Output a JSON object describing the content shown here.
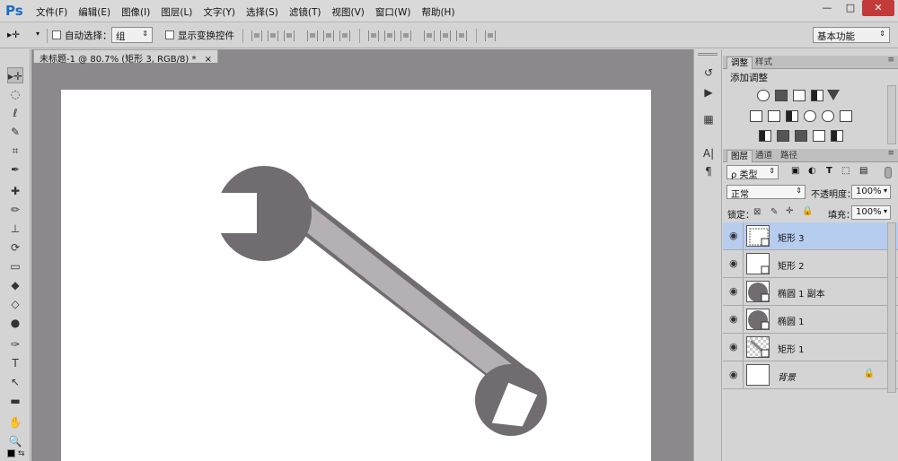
{
  "app": {
    "logo": "Ps"
  },
  "menu": [
    "文件(F)",
    "编辑(E)",
    "图像(I)",
    "图层(L)",
    "文字(Y)",
    "选择(S)",
    "滤镜(T)",
    "视图(V)",
    "窗口(W)",
    "帮助(H)"
  ],
  "window_controls": {
    "minimize": "—",
    "restore": "□",
    "close": "✕"
  },
  "options": {
    "move_tool": "▸✛",
    "auto_select_label": "自动选择：",
    "auto_select_value": "组",
    "show_transform_label": "显示变换控件",
    "workspace": "基本功能"
  },
  "document": {
    "tab_title": "未标题-1 @ 80.7% (矩形 3, RGB/8) *",
    "tab_close": "×"
  },
  "tools": [
    "▸✛",
    "◌",
    "ℓ",
    "✎",
    "⌗",
    "✒",
    "✚",
    "✏",
    "⊥",
    "⟳",
    "▭",
    "◆",
    "◇",
    "●",
    "✑",
    "T",
    "↖",
    "▬",
    "✋",
    "🔍"
  ],
  "mid_dock": [
    "↺",
    "▶",
    "▦",
    "A|",
    "¶"
  ],
  "adjustments": {
    "tabs": [
      "调整",
      "样式"
    ],
    "title": "添加调整"
  },
  "layers_panel": {
    "tabs": [
      "图层",
      "通道",
      "路径"
    ],
    "filter_kind": "ρ 类型",
    "blend_mode": "正常",
    "opacity_label": "不透明度：",
    "opacity_value": "100%",
    "lock_label": "锁定：",
    "fill_label": "填充：",
    "fill_value": "100%",
    "layers": [
      {
        "name": "矩形 3",
        "selected": true,
        "thumb": "rect-white-sq"
      },
      {
        "name": "矩形 2",
        "selected": false,
        "thumb": "rect-white-sq"
      },
      {
        "name": "椭圆 1 副本",
        "selected": false,
        "thumb": "ellipse"
      },
      {
        "name": "椭圆 1",
        "selected": false,
        "thumb": "ellipse"
      },
      {
        "name": "矩形 1",
        "selected": false,
        "thumb": "checker"
      },
      {
        "name": "背景",
        "selected": false,
        "thumb": "white",
        "locked": true
      }
    ]
  },
  "colors": {
    "wrench_dark": "#706c70",
    "wrench_handle": "#b4b0b4",
    "canvas_bg": "#ffffff",
    "pasteboard": "#8b898c",
    "selected_layer": "#b7cdf0",
    "logo_blue": "#1c6dc4"
  }
}
